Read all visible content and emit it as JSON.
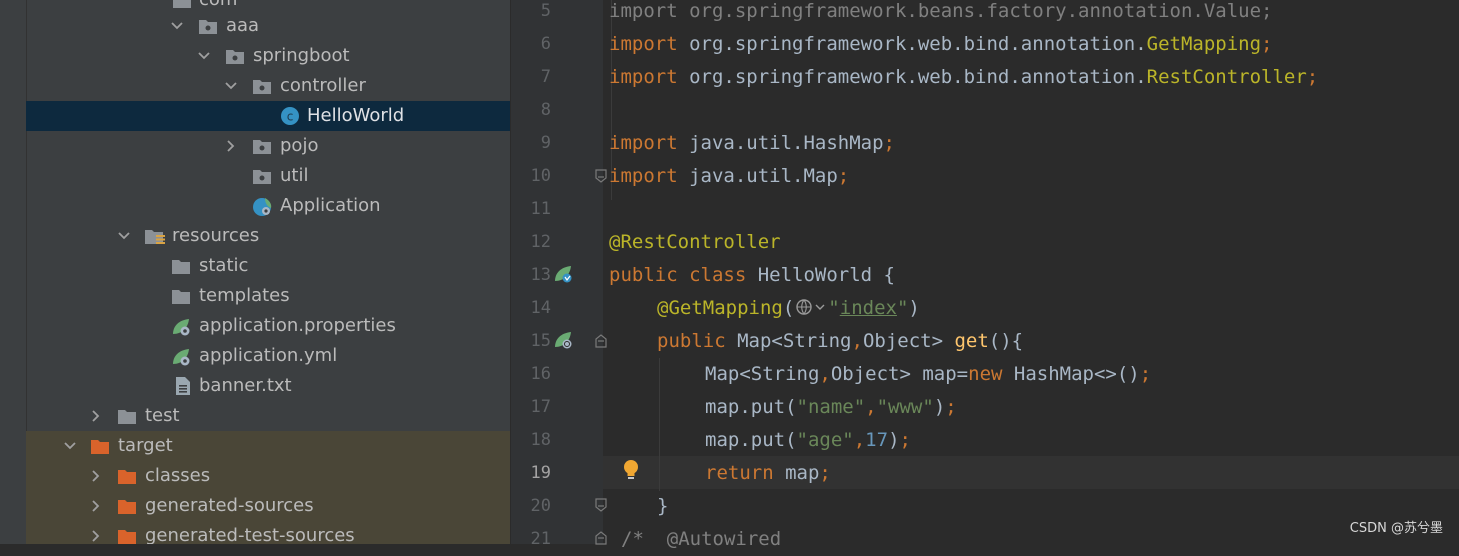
{
  "project_tree": {
    "items": [
      {
        "label": "com"
      },
      {
        "label": "aaa"
      },
      {
        "label": "springboot"
      },
      {
        "label": "controller"
      },
      {
        "label": "HelloWorld"
      },
      {
        "label": "pojo"
      },
      {
        "label": "util"
      },
      {
        "label": "Application"
      },
      {
        "label": "resources"
      },
      {
        "label": "static"
      },
      {
        "label": "templates"
      },
      {
        "label": "application.properties"
      },
      {
        "label": "application.yml"
      },
      {
        "label": "banner.txt"
      },
      {
        "label": "test"
      },
      {
        "label": "target"
      },
      {
        "label": "classes"
      },
      {
        "label": "generated-sources"
      },
      {
        "label": "generated-test-sources"
      }
    ]
  },
  "editor": {
    "line_numbers": [
      "5",
      "6",
      "7",
      "8",
      "9",
      "10",
      "11",
      "12",
      "13",
      "14",
      "15",
      "16",
      "17",
      "18",
      "19",
      "20",
      "21"
    ],
    "current_line": "19",
    "code": {
      "l5": {
        "kw": "import",
        "rest": " org.springframework.beans.factory.annotation.Value;"
      },
      "l6": {
        "kw": "import",
        "pkg": " org.springframework.web.bind.annotation.",
        "cls": "GetMapping",
        "end": ";"
      },
      "l7": {
        "kw": "import",
        "pkg": " org.springframework.web.bind.annotation.",
        "cls": "RestController",
        "end": ";"
      },
      "l9": {
        "kw": "import",
        "pkg": " java.util.HashMap",
        "end": ";"
      },
      "l10": {
        "kw": "import",
        "pkg": " java.util.Map",
        "end": ";"
      },
      "l12": {
        "ann": "@RestController"
      },
      "l13": {
        "kw": "public class",
        "rest": " HelloWorld {"
      },
      "l14": {
        "ann": "@GetMapping",
        "open": "(",
        "str_q1": "\"",
        "str": "index",
        "str_q2": "\"",
        "close": ")"
      },
      "l15": {
        "kw": "public",
        "type": " Map<String",
        "comma": ",",
        "type2": "Object> ",
        "fn": "get",
        "end": "(){"
      },
      "l16": {
        "type": "Map<String",
        "comma": ",",
        "type2": "Object> map=",
        "kw": "new",
        "rest": " HashMap<>()",
        "end": ";"
      },
      "l17": {
        "obj": "map.put(",
        "s1": "\"name\"",
        "comma": ",",
        "s2": "\"www\"",
        "end": ")",
        ";": ";"
      },
      "l18": {
        "obj": "map.put(",
        "s1": "\"age\"",
        "comma": ",",
        "num": "17",
        "end": ")",
        ";": ";"
      },
      "l19": {
        "kw": "return",
        "rest": " map",
        "end": ";"
      },
      "l20": {
        "rest": "}"
      },
      "l21": {
        "cm": "/*",
        "rest": "  @Autowired"
      }
    }
  },
  "watermark": "CSDN @苏兮墨"
}
